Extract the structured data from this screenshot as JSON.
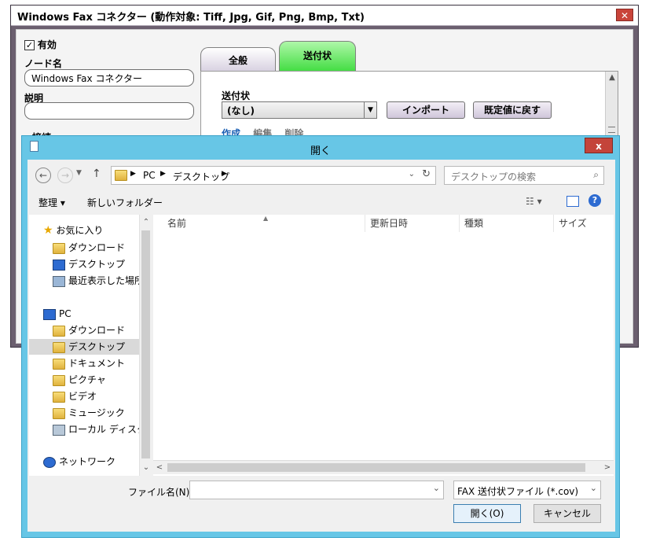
{
  "bg_window": {
    "title": "Windows Fax コネクター (動作対象: Tiff, Jpg, Gif, Png, Bmp, Txt)",
    "close": "✕",
    "enabled_label": "有効",
    "node_name_label": "ノード名",
    "node_name_value": "Windows Fax コネクター",
    "desc_label": "説明",
    "desc_value": "",
    "connection_label": "接続",
    "tabs": [
      {
        "label": "全般"
      },
      {
        "label": "送付状"
      }
    ],
    "cover_label": "送付状",
    "cover_select": "(なし)",
    "import_button": "インポート",
    "reset_button": "既定値に戻す",
    "links": [
      {
        "label": "作成"
      },
      {
        "label": "編集"
      },
      {
        "label": "削除"
      }
    ]
  },
  "dialog": {
    "title": "開く",
    "close": "x",
    "breadcrumb": [
      "PC",
      "デスクトップ"
    ],
    "search_placeholder": "デスクトップの検索",
    "organize": "整理 ▾",
    "new_folder": "新しいフォルダー",
    "nav": {
      "favorites": {
        "label": "お気に入り",
        "items": [
          "ダウンロード",
          "デスクトップ",
          "最近表示した場所"
        ]
      },
      "pc": {
        "label": "PC",
        "items": [
          "ダウンロード",
          "デスクトップ",
          "ドキュメント",
          "ピクチャ",
          "ビデオ",
          "ミュージック",
          "ローカル ディスク (C"
        ]
      },
      "network": "ネットワーク"
    },
    "columns": [
      "名前",
      "更新日時",
      "種類",
      "サイズ"
    ],
    "filename_label": "ファイル名(N):",
    "filename_value": "",
    "filetype": "FAX 送付状ファイル (*.cov)",
    "open_button": "開く(O)",
    "cancel_button": "キャンセル"
  },
  "colors": {
    "dialog_frame": "#67c6e6",
    "active_tab": "#3fdc3f",
    "link_blue": "#1a5fb4"
  }
}
